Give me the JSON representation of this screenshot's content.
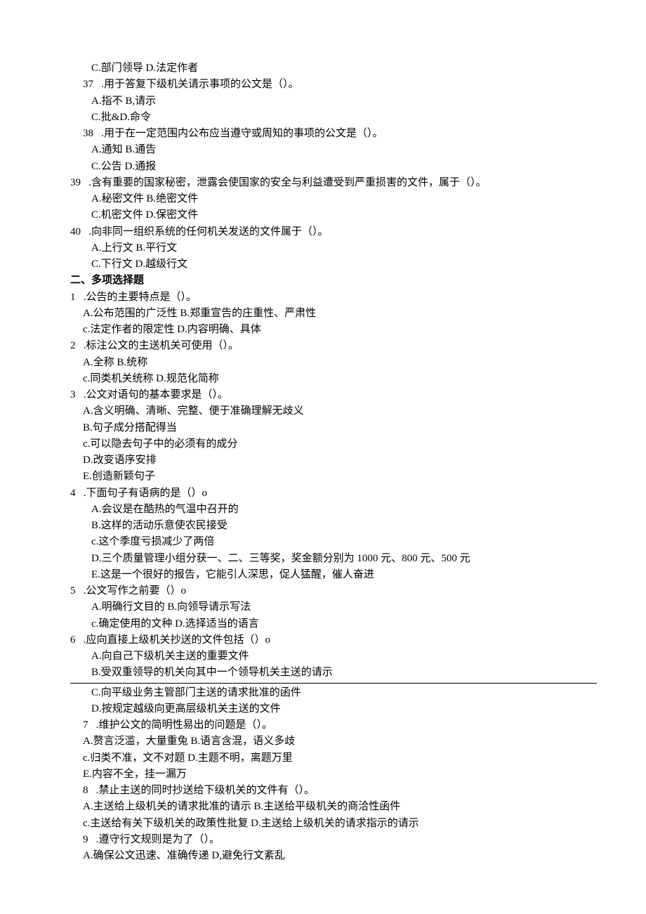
{
  "lines": [
    {
      "indent": 3,
      "text": "C.部门领导 D.法定作者"
    },
    {
      "indent": 2,
      "text": "37   .用于答复下级机关请示事项的公文是（）。"
    },
    {
      "indent": 3,
      "text": "A.指不 B,请示"
    },
    {
      "indent": 3,
      "text": "C.批&D.命令"
    },
    {
      "indent": 2,
      "text": "38   .用于在一定范围内公布应当遵守或周知的事项的公文是（）。"
    },
    {
      "indent": 3,
      "text": "A.通知 B.通告"
    },
    {
      "indent": 3,
      "text": "C.公告 D.通报"
    },
    {
      "indent": 0,
      "text": "39   .含有重要的国家秘密，泄露会使国家的安全与利益遭受到严重损害的文件，属于（）。"
    },
    {
      "indent": 3,
      "text": "A.秘密文件 B.绝密文件"
    },
    {
      "indent": 3,
      "text": "C.机密文件 D.保密文件"
    },
    {
      "indent": 0,
      "text": "40   .向非同一组织系统的任何机关发送的文件属于（）。"
    },
    {
      "indent": 3,
      "text": "A.上行文 B.平行文"
    },
    {
      "indent": 3,
      "text": "C.下行文 D.越级行文"
    },
    {
      "indent": 0,
      "text": "二、多项选择题",
      "bold": true
    },
    {
      "indent": 0,
      "text": "1   .公告的主要特点是（）。"
    },
    {
      "indent": 2,
      "text": "A.公布范围的广泛性 B.郑重宣告的庄重性、严肃性"
    },
    {
      "indent": 2,
      "text": "c.法定作者的限定性 D.内容明确、具体"
    },
    {
      "indent": 0,
      "text": "2   .标注公文的主送机关可使用（）。"
    },
    {
      "indent": 2,
      "text": "A.全称 B.统称"
    },
    {
      "indent": 2,
      "text": "c.同类机关统称 D.规范化简称"
    },
    {
      "indent": 0,
      "text": "3   .公文对语句的基本要求是（）。"
    },
    {
      "indent": 2,
      "text": "A.含义明确、清晰、完整、便于准确理解无歧义"
    },
    {
      "indent": 2,
      "text": "B.句子成分搭配得当"
    },
    {
      "indent": 2,
      "text": "c.可以隐去句子中的必须有的成分"
    },
    {
      "indent": 2,
      "text": "D.改变语序安排"
    },
    {
      "indent": 2,
      "text": "E.创造新颖句子"
    },
    {
      "indent": 0,
      "text": "4   .下面句子有语病的是（）o"
    },
    {
      "indent": 3,
      "text": "A.会议是在酷热的气温中召开的"
    },
    {
      "indent": 3,
      "text": "B.这样的活动乐意使农民接受"
    },
    {
      "indent": 3,
      "text": "c.这个季度亏损减少了两倍"
    },
    {
      "indent": 3,
      "text": "D.三个质量管理小组分获一、二、三等奖，奖金额分别为 1000 元、800 元、500 元"
    },
    {
      "indent": 3,
      "text": "E.这是一个很好的报告，它能引人深思，促人猛醒，催人奋进"
    },
    {
      "indent": 0,
      "text": "5   .公文写作之前要（）o"
    },
    {
      "indent": 3,
      "text": "A.明确行文目的 B.向领导请示写法"
    },
    {
      "indent": 3,
      "text": "c.确定使用的文种 D.选择适当的语言"
    },
    {
      "indent": 0,
      "text": "6   .应向直接上级机关抄送的文件包括（）o"
    },
    {
      "indent": 3,
      "text": "A.向自己下级机关主送的重要文件"
    },
    {
      "indent": 3,
      "text": "B.受双重领导的机关向其中一个领导机关主送的请示"
    },
    {
      "hr": true
    },
    {
      "indent": 3,
      "text": "C.向平级业务主管部门主送的请求批准的函件"
    },
    {
      "indent": 3,
      "text": "D.按规定越级向更高层级机关主送的文件"
    },
    {
      "indent": 2,
      "text": "7   .维护公文的简明性易出的问题是（）。"
    },
    {
      "indent": 2,
      "text": "A.赘言泛滥，大量重兔 B.语言含混，语义多歧"
    },
    {
      "indent": 2,
      "text": "c.归类不准，文不对题 D.主题不明，离题万里"
    },
    {
      "indent": 2,
      "text": "E.内容不全，挂一漏万"
    },
    {
      "indent": 2,
      "text": "8   .禁止主送的同时抄送给下级机关的文件有（）。"
    },
    {
      "indent": 2,
      "text": "A.主送给上级机关的请求批准的请示 B.主送给平级机关的商洽性函件"
    },
    {
      "indent": 2,
      "text": "c.主送给有关下级机关的政策性批复 D.主送给上级机关的请求指示的请示"
    },
    {
      "indent": 2,
      "text": "9   .遵守行文规则是为了（）。"
    },
    {
      "indent": 2,
      "text": "A.确保公文迅速、准确传递 D,避免行文紊乱"
    }
  ]
}
